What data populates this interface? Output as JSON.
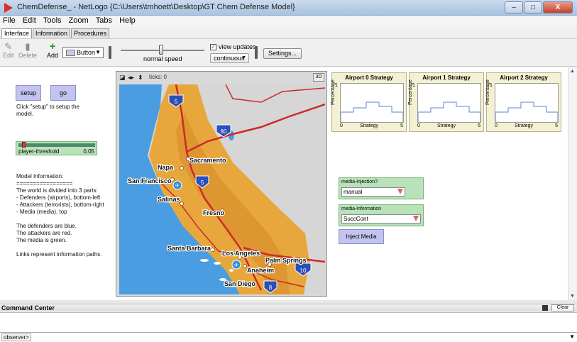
{
  "window": {
    "title": "ChemDefense_ - NetLogo {C:\\Users\\tmhoett\\Desktop\\GT Chem Defense Model}",
    "controls": [
      "–",
      "□",
      "X"
    ]
  },
  "menu": [
    "File",
    "Edit",
    "Tools",
    "Zoom",
    "Tabs",
    "Help"
  ],
  "tabs": [
    "Interface",
    "Information",
    "Procedures"
  ],
  "toolbar": {
    "edit": "Edit",
    "delete": "Delete",
    "add": "Add",
    "widget_type": "Button",
    "speed_label": "normal speed",
    "speed_level": 0.48,
    "view_updates_label": "view updates",
    "view_updates_checked": "✓",
    "update_mode": "continuous",
    "settings": "Settings..."
  },
  "interface": {
    "setup_button": "setup",
    "go_button": "go",
    "setup_note": "Click \"setup\" to setup the\nmodel.",
    "slider": {
      "name": "player-threshold",
      "value": "0.05",
      "fraction": 0.05
    },
    "model_info": "Model Information:\n=================\nThe world is divided into 3 parts:\n- Defenders (airports), bottom-left\n- Attackers (terrorists), bottom-right\n- Media (media), top\n\nThe defenders are blue.\nThe attackers are red.\nThe media is green.\n\nLinks represent information paths."
  },
  "world": {
    "ticks_label": "ticks: 0",
    "btn3d": "3D",
    "cities": [
      "Sacramento",
      "Napa",
      "San Francisco",
      "Salinas",
      "Fresno",
      "Santa Barbara",
      "Los Angeles",
      "Palm Springs",
      "Anaheim",
      "San Diego"
    ],
    "shields": [
      "5",
      "80",
      "5",
      "10",
      "8"
    ]
  },
  "plots": [
    {
      "title": "Airport 0 Strategy",
      "ylabel": "Percentage",
      "xlabel": "Strategy",
      "y_max": "1",
      "x_min": "0",
      "x_max": "5"
    },
    {
      "title": "Airport 1 Strategy",
      "ylabel": "Percentage",
      "xlabel": "Strategy",
      "y_max": "1",
      "x_min": "0",
      "x_max": "5"
    },
    {
      "title": "Airport 2 Strategy",
      "ylabel": "Percentage",
      "xlabel": "Strategy",
      "y_max": "1",
      "x_min": "0",
      "x_max": "5"
    }
  ],
  "choosers": [
    {
      "name": "media-injection?",
      "value": "manual"
    },
    {
      "name": "media-information",
      "value": "SuccCont"
    }
  ],
  "inject_button": "Inject Media",
  "command_center": {
    "title": "Command Center",
    "clear": "Clear",
    "observer": "observer>"
  },
  "colors": {
    "button": "#c3c3f0",
    "widget_green": "#b8e2b8",
    "plot_bg": "#f4f1d2",
    "map_land": "#e8a73c",
    "map_ocean": "#4a9de0",
    "highway": "#cc2a2a"
  }
}
